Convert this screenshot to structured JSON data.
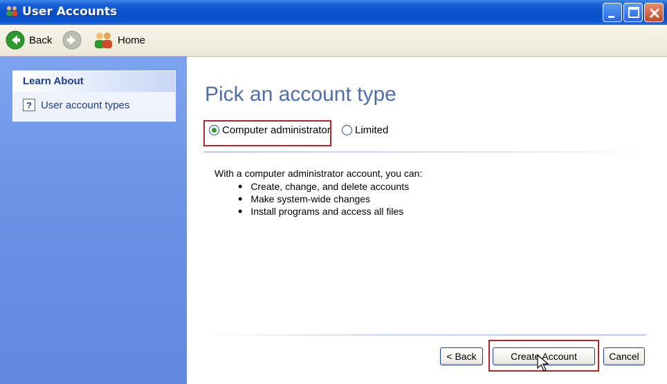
{
  "window": {
    "title": "User Accounts"
  },
  "toolbar": {
    "back_label": "Back",
    "home_label": "Home"
  },
  "sidebar": {
    "section_title": "Learn About",
    "items": [
      {
        "label": "User account types"
      }
    ]
  },
  "main": {
    "title": "Pick an account type",
    "options": [
      {
        "label": "Computer administrator",
        "selected": true
      },
      {
        "label": "Limited",
        "selected": false
      }
    ],
    "description": "With a computer administrator account, you can:",
    "bullets": [
      "Create, change, and delete accounts",
      "Make system-wide changes",
      "Install programs and access all files"
    ]
  },
  "buttons": {
    "back": "< Back",
    "create": "Create Account",
    "cancel": "Cancel"
  },
  "colors": {
    "titlebar": "#0a4fc8",
    "sidebar": "#6d93e6",
    "highlight": "#b3232d",
    "page_title": "#4f6ea8"
  }
}
